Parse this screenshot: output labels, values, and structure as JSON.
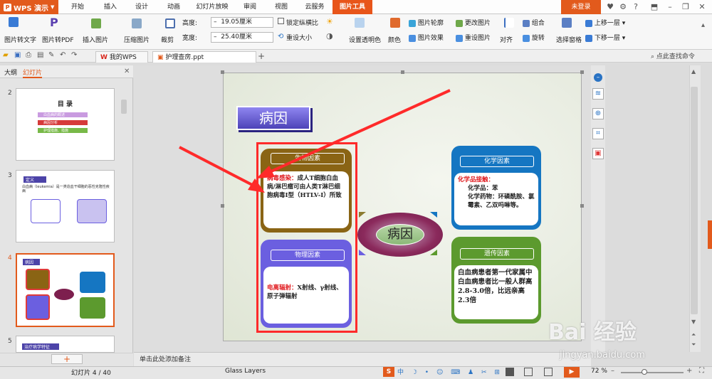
{
  "app": {
    "name": "WPS 演示",
    "login": "未登录"
  },
  "ribbon_tabs": [
    "开始",
    "插入",
    "设计",
    "动画",
    "幻灯片放映",
    "审阅",
    "视图",
    "云服务",
    "图片工具"
  ],
  "active_tab": "图片工具",
  "toolbar": {
    "pic_to_text": "图片转文字",
    "pic_to_pdf": "图片转PDF",
    "insert_pic": "插入图片",
    "compress": "压缩图片",
    "crop": "裁剪",
    "height_label": "高度:",
    "height_value": "19.05厘米",
    "width_label": "宽度:",
    "width_value": "25.40厘米",
    "lock_ratio": "锁定纵横比",
    "reset_size": "重设大小",
    "set_transparent": "设置透明色",
    "color": "颜色",
    "pic_outline": "图片轮廓",
    "pic_effect": "图片效果",
    "change_pic": "更改图片",
    "reset_pic": "重设图片",
    "align": "对齐",
    "group": "组合",
    "rotate": "旋转",
    "select_pane": "选择窗格",
    "bring_forward": "上移一层",
    "send_backward": "下移一层"
  },
  "doc_tabs": [
    {
      "label": "我的WPS"
    },
    {
      "label": "护理查房.ppt"
    }
  ],
  "search_cmd": "点此查找命令",
  "panel_tabs": {
    "outline": "大纲",
    "slides": "幻灯片"
  },
  "thumbs": [
    {
      "num": "2",
      "title": "目 录",
      "items": [
        "白血病的概述",
        "病因分析",
        "护理措施、措施"
      ]
    },
    {
      "num": "3",
      "title": "定义",
      "text": "白血病（leukemia）是一类造血干细胞的恶性克隆性疾病"
    },
    {
      "num": "4",
      "title": "病因"
    },
    {
      "num": "5",
      "title": "治疗病学特征"
    }
  ],
  "slide": {
    "title": "病因",
    "center": "病因",
    "bio": {
      "title": "生物因素",
      "red": "病毒感染：",
      "body": "成人T细胞白血病/淋巴瘤可由人类T淋巴细胞病毒I型（HTLV-I）所致"
    },
    "phys": {
      "title": "物理因素",
      "red": "电离辐射：",
      "body": "X射线、γ射线、原子弹辐射"
    },
    "chem": {
      "title": "化学因素",
      "red": "化学品接触：",
      "line1": "化学品：苯",
      "line2": "化学药物：环磷酰胺、氯霉素、乙双吗啉等。"
    },
    "gene": {
      "title": "遗传因素",
      "body": "白血病患者第一代家属中白血病患者比一般人群高2.8-3.0倍，比远亲高2.3倍"
    }
  },
  "notes_placeholder": "单击此处添加备注",
  "status": {
    "slide_info": "幻灯片 4 / 40",
    "theme": "Glass Layers",
    "zoom": "72 %"
  },
  "watermark": {
    "brand": "Bai 经验",
    "url": "jingyan.baidu.com"
  },
  "colors": {
    "accent": "#e8551a",
    "highlight": "#ff2a2a",
    "blue_box": "#1576c2",
    "green_box": "#5c9a2e",
    "brown_box": "#8a6414",
    "purple_box": "#6b5fe0"
  }
}
